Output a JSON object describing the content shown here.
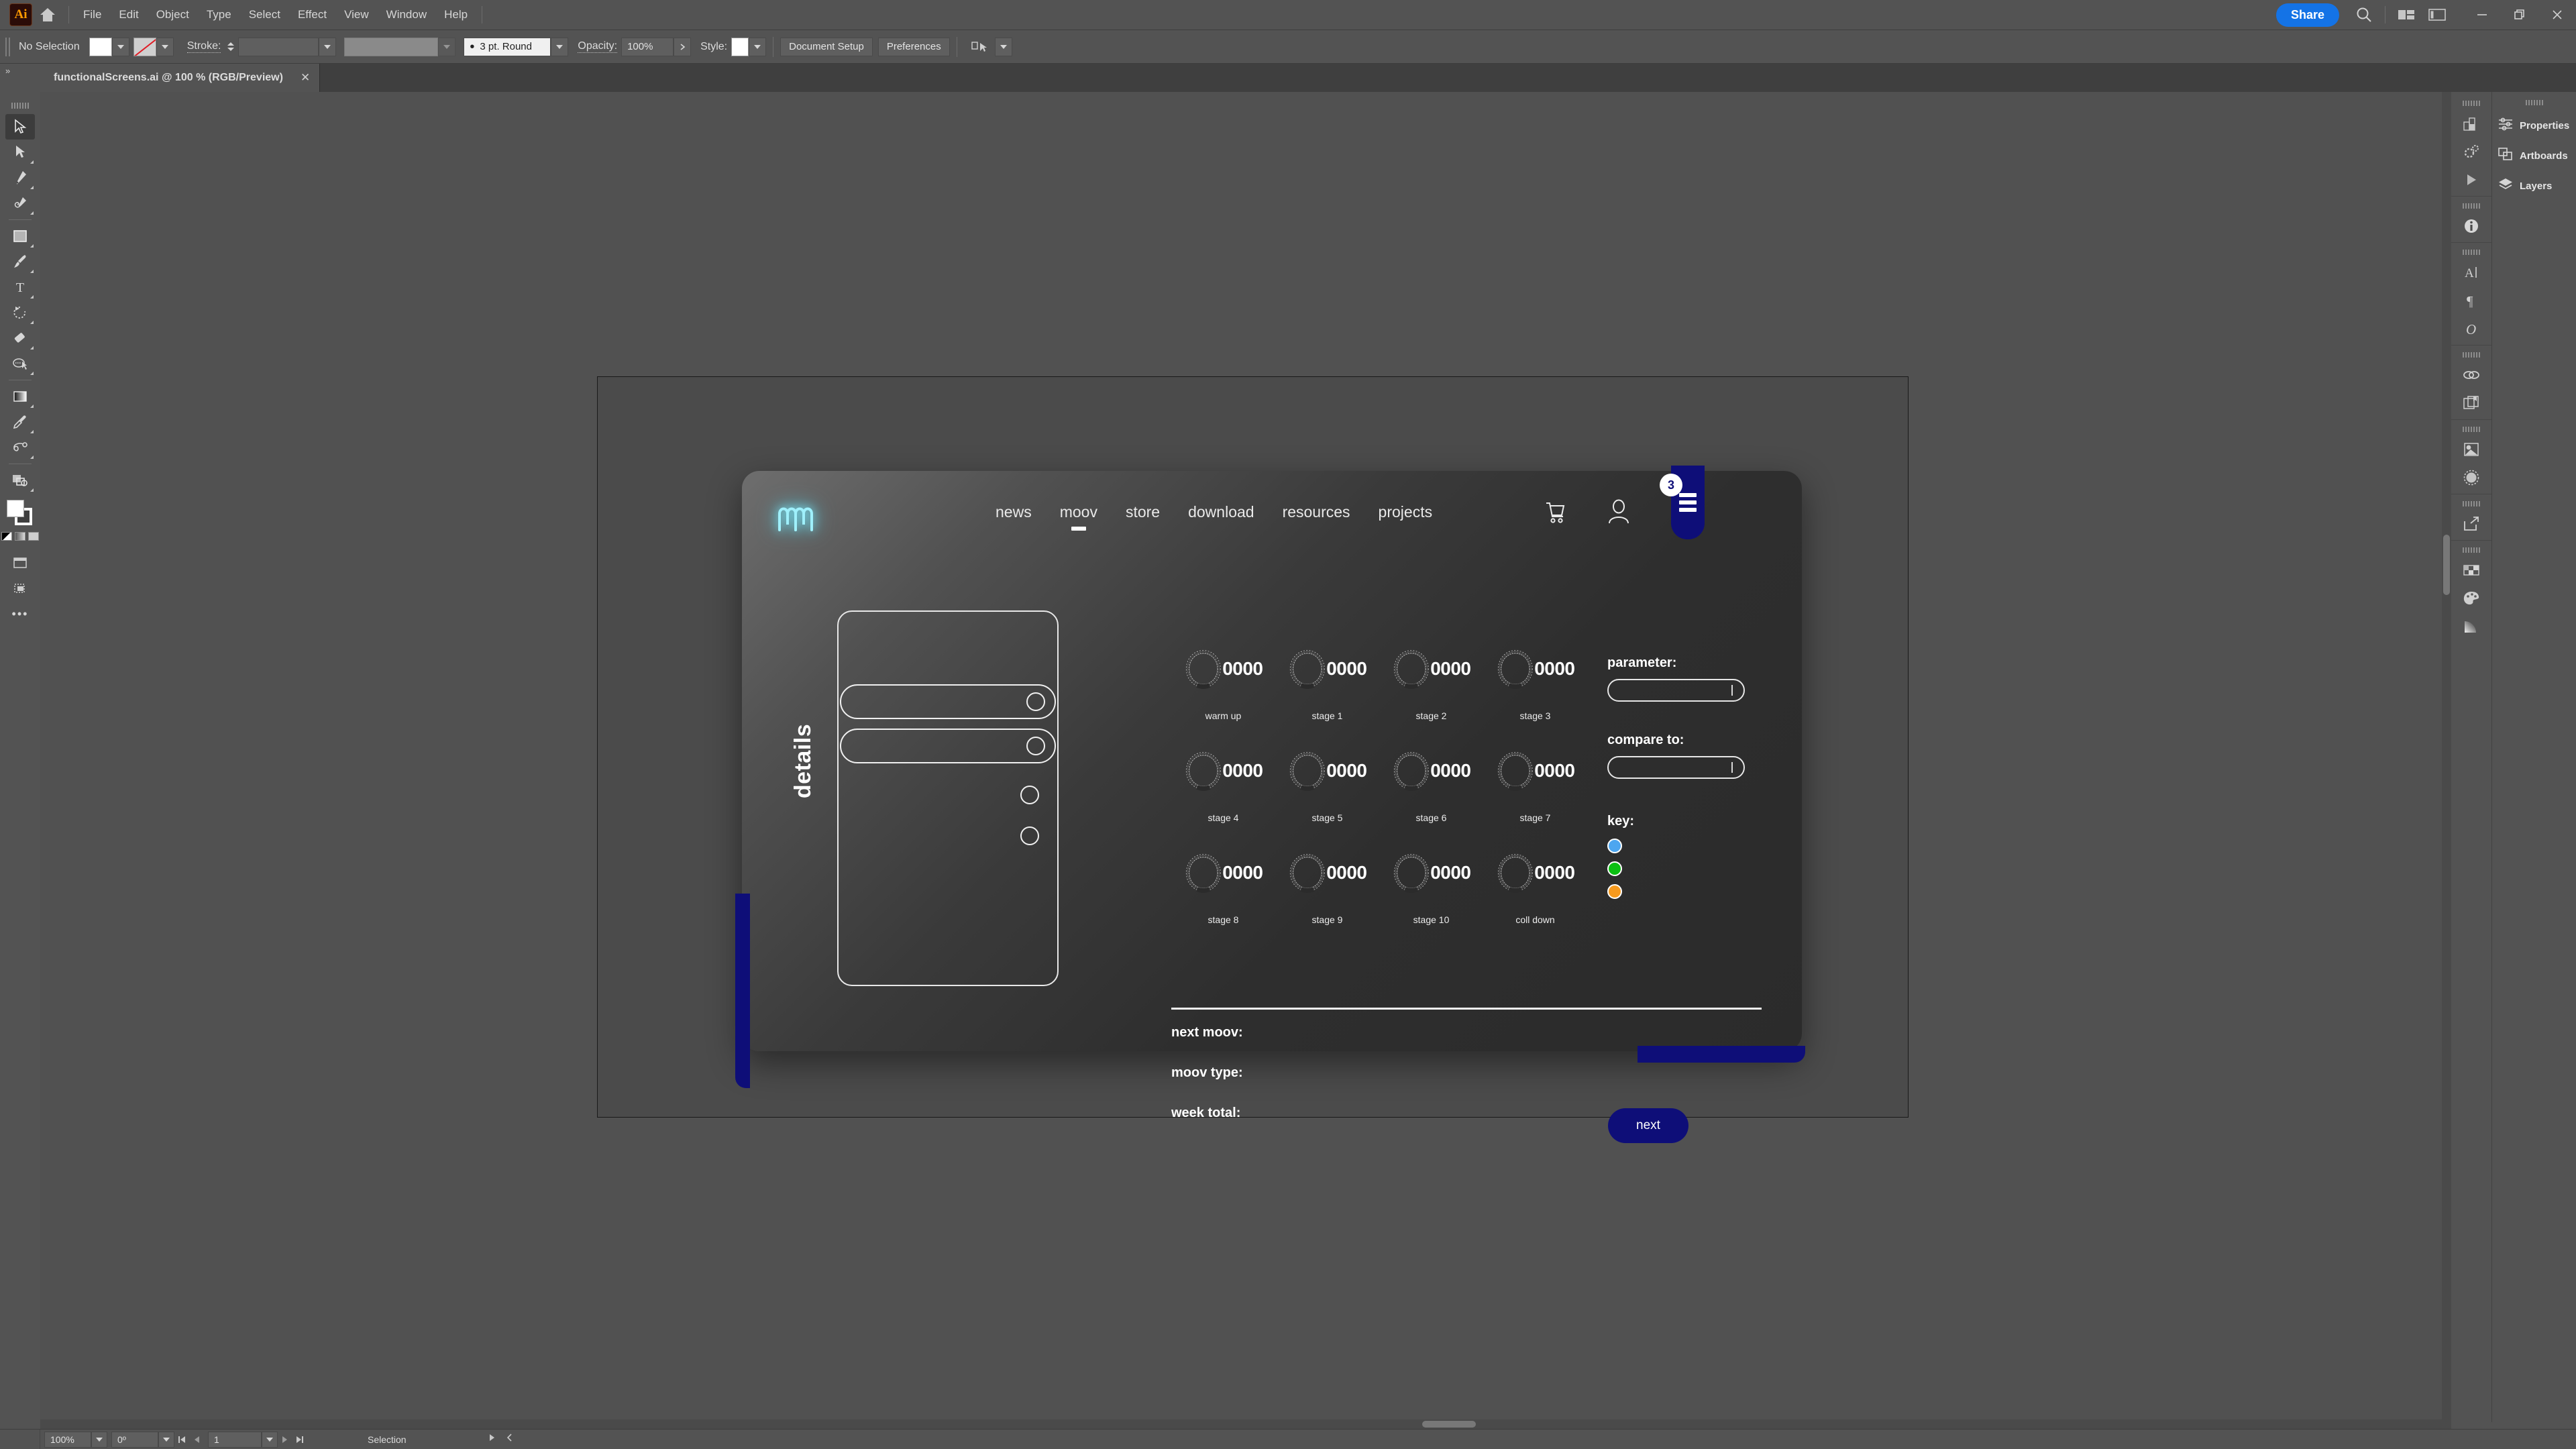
{
  "app": {
    "logo_text": "Ai",
    "menus": [
      "File",
      "Edit",
      "Object",
      "Type",
      "Select",
      "Effect",
      "View",
      "Window",
      "Help"
    ],
    "share_label": "Share"
  },
  "control_bar": {
    "selection_state": "No Selection",
    "stroke_label": "Stroke:",
    "stroke_value": "",
    "brush_value": "3 pt. Round",
    "opacity_label": "Opacity:",
    "opacity_value": "100%",
    "style_label": "Style:",
    "document_setup": "Document Setup",
    "preferences": "Preferences"
  },
  "document_tab": {
    "title": "functionalScreens.ai @ 100 % (RGB/Preview)",
    "close": "✕"
  },
  "right_panel": {
    "items": [
      {
        "label": "Properties",
        "icon": "sliders-icon"
      },
      {
        "label": "Artboards",
        "icon": "artboards-icon"
      },
      {
        "label": "Layers",
        "icon": "layers-icon"
      }
    ]
  },
  "right_rail_icons": [
    "info-icon",
    "character-icon",
    "paragraph-icon",
    "opentype-icon",
    "links-icon",
    "libraries-icon",
    "image-trace-icon",
    "transparency-icon",
    "export-icon",
    "swatches-icon",
    "color-palette-icon",
    "gradient-icon"
  ],
  "tool_icons": [
    "selection-tool-icon",
    "direct-selection-tool-icon",
    "pen-tool-icon",
    "curvature-tool-icon",
    "shape-tool-icon",
    "paintbrush-tool-icon",
    "type-tool-icon",
    "rotate-tool-icon",
    "eraser-tool-icon",
    "width-tool-icon",
    "gradient-tool-icon",
    "eyedropper-tool-icon",
    "blend-tool-icon",
    "artboard-tool-icon",
    "hand-tool-icon",
    "zoom-tool-icon"
  ],
  "status_bar": {
    "zoom": "100%",
    "rotation": "0º",
    "artboard_number": "1",
    "status": "Selection"
  },
  "design": {
    "logo": "moov-logo-icon",
    "nav": [
      {
        "label": "news",
        "active": false
      },
      {
        "label": "moov",
        "active": true
      },
      {
        "label": "store",
        "active": false
      },
      {
        "label": "download",
        "active": false
      },
      {
        "label": "resources",
        "active": false
      },
      {
        "label": "projects",
        "active": false
      }
    ],
    "cart_icon": "cart-icon",
    "account_icon": "user-account-icon",
    "menu_icon": "hamburger-menu-icon",
    "notification_count": "3",
    "details_label": "details",
    "details_rows": [
      {
        "has_dot": true
      },
      {
        "has_dot": true
      }
    ],
    "loose_dots": 2,
    "dials": [
      {
        "value": "0000",
        "label": "warm up"
      },
      {
        "value": "0000",
        "label": "stage 1"
      },
      {
        "value": "0000",
        "label": "stage 2"
      },
      {
        "value": "0000",
        "label": "stage 3"
      },
      {
        "value": "0000",
        "label": "stage 4"
      },
      {
        "value": "0000",
        "label": "stage 5"
      },
      {
        "value": "0000",
        "label": "stage 6"
      },
      {
        "value": "0000",
        "label": "stage 7"
      },
      {
        "value": "0000",
        "label": "stage 8"
      },
      {
        "value": "0000",
        "label": "stage 9"
      },
      {
        "value": "0000",
        "label": "stage 10"
      },
      {
        "value": "0000",
        "label": "coll down"
      }
    ],
    "form": {
      "parameter_label": "parameter:",
      "parameter_value": "",
      "compare_label": "compare to:",
      "compare_value": "",
      "key_label": "key:",
      "key_colors": [
        "#4da6f0",
        "#0bbf12",
        "#f79a1e"
      ]
    },
    "summary": [
      {
        "label": "next moov:"
      },
      {
        "label": "moov type:"
      },
      {
        "label": "week total:"
      }
    ],
    "next_button": "next",
    "accent_color": "#0e0e78"
  }
}
